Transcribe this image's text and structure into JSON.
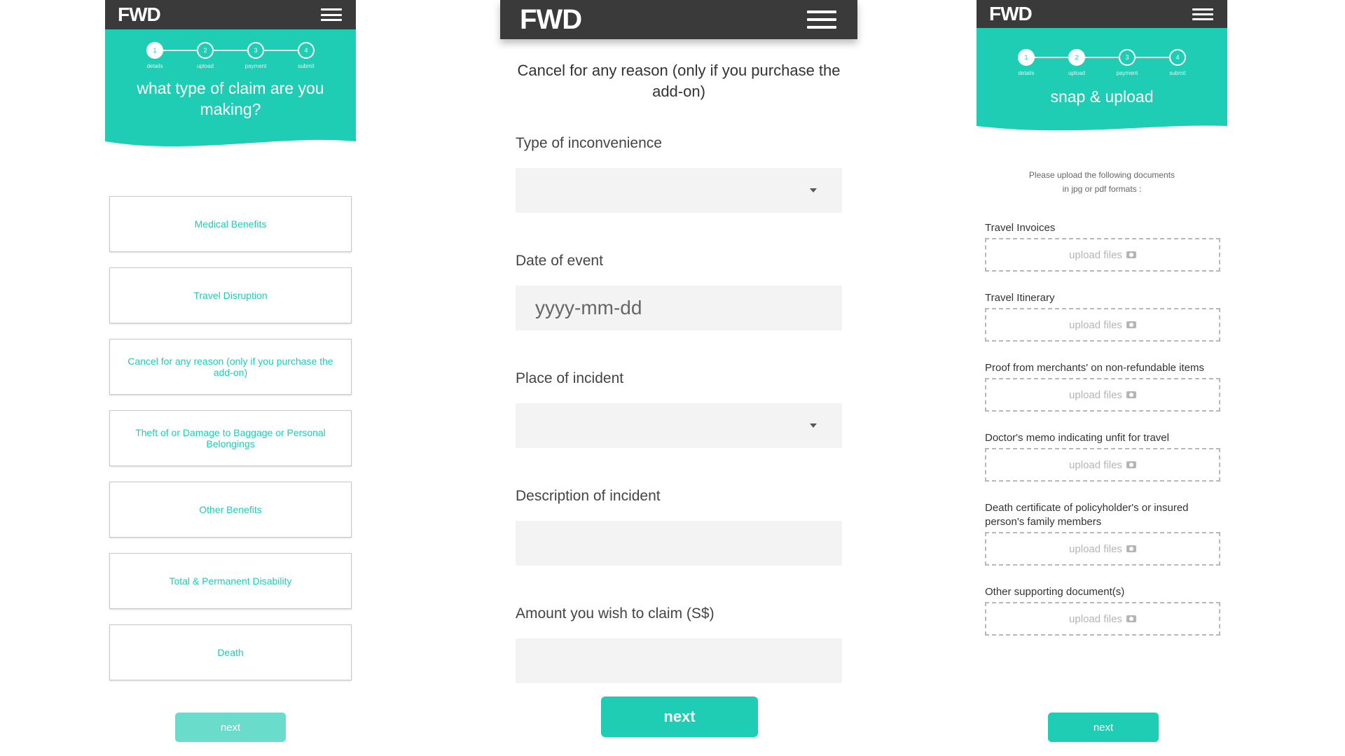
{
  "brand": {
    "logo": "FWD",
    "teal": "#1ecdb4",
    "header_bg": "#3a3a3a",
    "accent_orange": "#f47920"
  },
  "steps": {
    "numbers": [
      "1",
      "2",
      "3",
      "4"
    ],
    "labels": [
      "details",
      "upload",
      "payment",
      "submit"
    ]
  },
  "screen1": {
    "title": "what type of claim are you making?",
    "claim_types": [
      "Medical Benefits",
      "Travel Disruption",
      "Cancel for any reason (only if you purchase the add-on)",
      "Theft of or Damage to Baggage or Personal Belongings",
      "Other Benefits",
      "Total & Permanent Disability",
      "Death"
    ],
    "next_label": "next"
  },
  "screen2": {
    "title": "Cancel for any reason (only if you purchase the add-on)",
    "fields": [
      {
        "label": "Type of inconvenience",
        "kind": "select",
        "value": ""
      },
      {
        "label": "Date of event",
        "kind": "date",
        "placeholder": "yyyy-mm-dd"
      },
      {
        "label": "Place of incident",
        "kind": "select",
        "value": ""
      },
      {
        "label": "Description of incident",
        "kind": "text",
        "value": ""
      },
      {
        "label": "Amount you wish to claim (S$)",
        "kind": "text",
        "value": ""
      }
    ],
    "next_label": "next"
  },
  "screen3": {
    "title": "snap & upload",
    "intro": "Please upload the following documents in jpg or pdf formats :",
    "documents": [
      "Travel Invoices",
      "Travel Itinerary",
      "Proof from merchants' on non-refundable items",
      "Doctor's memo indicating unfit for travel",
      "Death certificate of policyholder's or insured person's family members",
      "Other supporting document(s)"
    ],
    "upload_label": "upload files",
    "next_label": "next"
  }
}
